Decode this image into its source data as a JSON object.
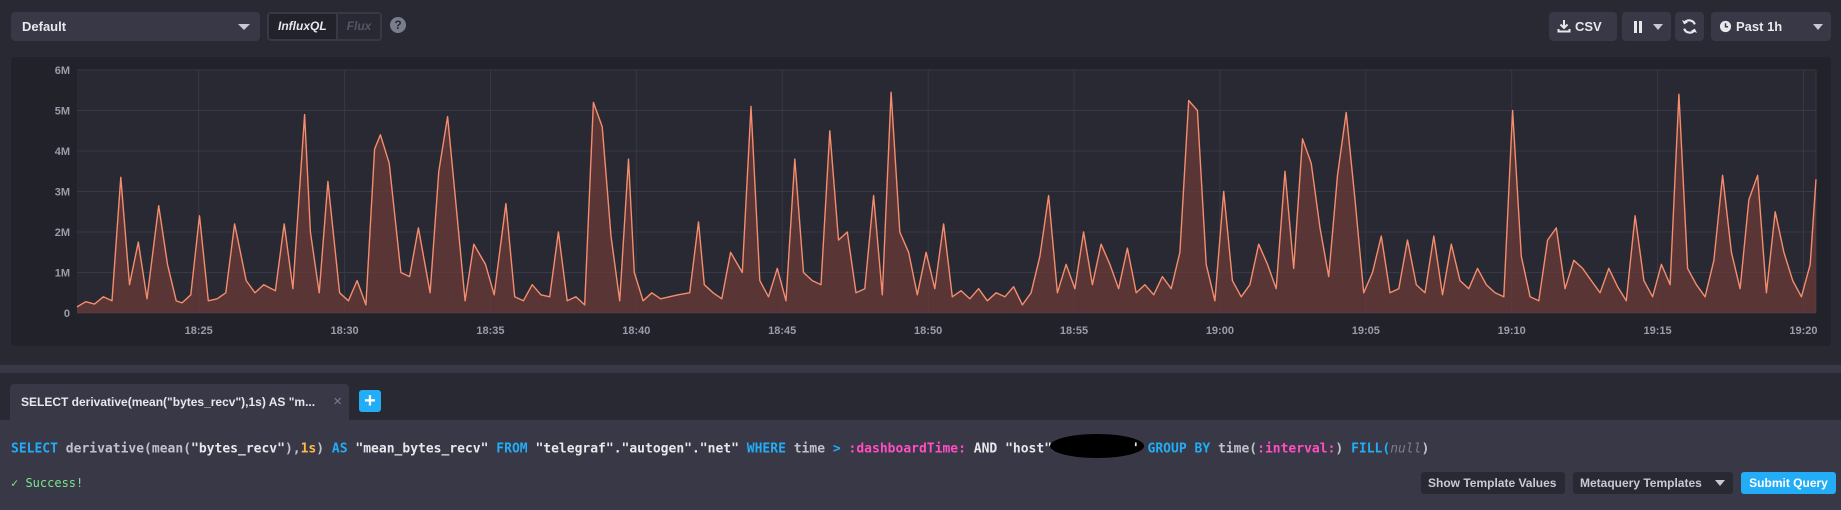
{
  "toolbar": {
    "database_selected": "Default",
    "lang_influxql": "InfluxQL",
    "lang_flux": "Flux",
    "help_glyph": "?",
    "csv_label": "CSV",
    "time_range": "Past 1h"
  },
  "chart_data": {
    "type": "area",
    "ylim": [
      0,
      6000000
    ],
    "y_ticks": [
      "0",
      "1M",
      "2M",
      "3M",
      "4M",
      "5M",
      "6M"
    ],
    "y_tick_values": [
      0,
      1000000,
      2000000,
      3000000,
      4000000,
      5000000,
      6000000
    ],
    "x_tick_labels": [
      "18:25",
      "18:30",
      "18:35",
      "18:40",
      "18:45",
      "18:50",
      "18:55",
      "19:00",
      "19:05",
      "19:10",
      "19:15",
      "19:20"
    ],
    "x_range_minutes": [
      0,
      59.6
    ],
    "x_tick_minutes": [
      4.17,
      9.17,
      14.17,
      19.17,
      24.17,
      29.17,
      34.17,
      39.17,
      44.17,
      49.17,
      54.17,
      59.17
    ],
    "line_color": "#f48d6d",
    "fill_color": "#6e3a38",
    "series": [
      {
        "x_minutes": [
          0,
          0.3,
          0.6,
          0.9,
          1.2,
          1.5,
          1.8,
          2.1,
          2.4,
          2.8,
          3.1,
          3.4,
          3.6,
          3.9,
          4.2,
          4.5,
          4.8,
          5.1,
          5.4,
          5.8,
          6.1,
          6.4,
          6.8,
          7.1,
          7.4,
          7.8,
          8.0,
          8.3,
          8.6,
          9.0,
          9.3,
          9.6,
          9.9,
          10.2,
          10.4,
          10.7,
          11.1,
          11.4,
          11.7,
          12.1,
          12.4,
          12.7,
          13.0,
          13.3,
          13.6,
          14.0,
          14.3,
          14.7,
          15.0,
          15.3,
          15.6,
          15.9,
          16.2,
          16.5,
          16.8,
          17.1,
          17.4,
          17.7,
          18.0,
          18.3,
          18.6,
          18.9,
          19.1,
          19.4,
          19.7,
          20.0,
          20.3,
          20.6,
          21.0,
          21.3,
          21.5,
          21.8,
          22.1,
          22.4,
          22.8,
          23.1,
          23.4,
          23.7,
          24.0,
          24.3,
          24.6,
          24.9,
          25.2,
          25.5,
          25.8,
          26.1,
          26.4,
          26.7,
          27.0,
          27.3,
          27.6,
          27.9,
          28.2,
          28.5,
          28.8,
          29.1,
          29.4,
          29.7,
          30.0,
          30.3,
          30.6,
          30.9,
          31.2,
          31.5,
          31.8,
          32.1,
          32.4,
          32.7,
          33.0,
          33.3,
          33.6,
          33.9,
          34.2,
          34.5,
          34.8,
          35.1,
          35.4,
          35.7,
          36.0,
          36.3,
          36.6,
          36.9,
          37.2,
          37.5,
          37.8,
          38.1,
          38.4,
          38.7,
          39.0,
          39.3,
          39.6,
          39.9,
          40.2,
          40.5,
          40.8,
          41.1,
          41.4,
          41.7,
          42.0,
          42.3,
          42.6,
          42.9,
          43.2,
          43.5,
          43.8,
          44.1,
          44.4,
          44.7,
          45.0,
          45.3,
          45.6,
          45.9,
          46.2,
          46.5,
          46.8,
          47.1,
          47.4,
          47.7,
          48.0,
          48.3,
          48.6,
          48.9,
          49.2,
          49.5,
          49.8,
          50.1,
          50.4,
          50.7,
          51.0,
          51.3,
          51.6,
          51.9,
          52.2,
          52.5,
          52.8,
          53.1,
          53.4,
          53.7,
          54.0,
          54.3,
          54.6,
          54.9,
          55.2,
          55.5,
          55.8,
          56.1,
          56.4,
          56.7,
          57.0,
          57.3,
          57.6,
          57.9,
          58.2,
          58.5,
          58.8,
          59.1,
          59.4,
          59.6
        ],
        "values": [
          150000,
          280000,
          220000,
          400000,
          300000,
          3350000,
          700000,
          1750000,
          350000,
          2650000,
          1200000,
          300000,
          250000,
          450000,
          2400000,
          300000,
          350000,
          500000,
          2200000,
          800000,
          500000,
          700000,
          550000,
          2200000,
          600000,
          4900000,
          2000000,
          500000,
          3250000,
          500000,
          300000,
          800000,
          200000,
          4050000,
          4400000,
          3700000,
          1000000,
          900000,
          2100000,
          500000,
          3500000,
          4850000,
          2600000,
          300000,
          1700000,
          1200000,
          450000,
          2700000,
          400000,
          300000,
          700000,
          450000,
          400000,
          2000000,
          300000,
          400000,
          200000,
          5200000,
          4600000,
          1900000,
          300000,
          3800000,
          1000000,
          300000,
          500000,
          350000,
          400000,
          450000,
          500000,
          2250000,
          700000,
          500000,
          350000,
          1500000,
          1000000,
          5100000,
          800000,
          400000,
          1100000,
          300000,
          3800000,
          1000000,
          800000,
          700000,
          4500000,
          1800000,
          2000000,
          500000,
          600000,
          2900000,
          450000,
          5450000,
          2000000,
          1500000,
          450000,
          1500000,
          600000,
          2200000,
          400000,
          550000,
          350000,
          600000,
          300000,
          500000,
          400000,
          650000,
          200000,
          500000,
          1400000,
          2900000,
          500000,
          1200000,
          600000,
          2000000,
          700000,
          1700000,
          1200000,
          600000,
          1600000,
          500000,
          700000,
          450000,
          900000,
          600000,
          1500000,
          5250000,
          5000000,
          1200000,
          300000,
          3000000,
          800000,
          400000,
          700000,
          1700000,
          1200000,
          600000,
          3500000,
          1100000,
          4300000,
          3700000,
          2100000,
          900000,
          3400000,
          4950000,
          2800000,
          500000,
          1000000,
          1900000,
          500000,
          600000,
          1800000,
          700000,
          500000,
          1900000,
          450000,
          1700000,
          800000,
          600000,
          1100000,
          700000,
          500000,
          400000,
          5000000,
          1400000,
          400000,
          300000,
          1800000,
          2100000,
          600000,
          1300000,
          1100000,
          800000,
          500000,
          1100000,
          650000,
          300000,
          2400000,
          800000,
          400000,
          1200000,
          700000,
          5400000,
          1100000,
          700000,
          400000,
          1300000,
          3400000,
          1500000,
          600000,
          2800000,
          3400000,
          500000,
          2500000,
          1500000,
          800000,
          400000,
          1200000,
          3300000,
          1000000,
          5750000,
          2800000,
          500000,
          3750000,
          1100000,
          500000,
          350000,
          600000
        ]
      }
    ]
  },
  "query_tab": {
    "title": "SELECT derivative(mean(\"bytes_recv\"),1s) AS \"m...",
    "close_glyph": "×",
    "add_glyph": "+"
  },
  "editor": {
    "q_select": "SELECT",
    "q_func": " derivative(mean(",
    "q_field": "\"bytes_recv\"",
    "q_comma": "),",
    "q_num": "1s",
    "q_paren": ")",
    "q_as": " AS ",
    "q_alias": "\"mean_bytes_recv\"",
    "q_from": " FROM ",
    "q_measurement": "\"telegraf\".\"autogen\".\"net\"",
    "q_where": " WHERE ",
    "q_time": "time",
    "q_gt": " > ",
    "q_dashtime": ":dashboardTime:",
    "q_and": " AND ",
    "q_host": "\"host\"=",
    "q_host_end": "'",
    "q_groupby": " GROUP BY ",
    "q_timefn": "time(",
    "q_interval": ":interval:",
    "q_close": ") ",
    "q_fill": "FILL(",
    "q_null": "null",
    "q_end": ")",
    "status_text": "✓ Success!",
    "btn_template_values": "Show Template Values",
    "btn_metaquery": "Metaquery Templates",
    "btn_submit": "Submit Query"
  }
}
